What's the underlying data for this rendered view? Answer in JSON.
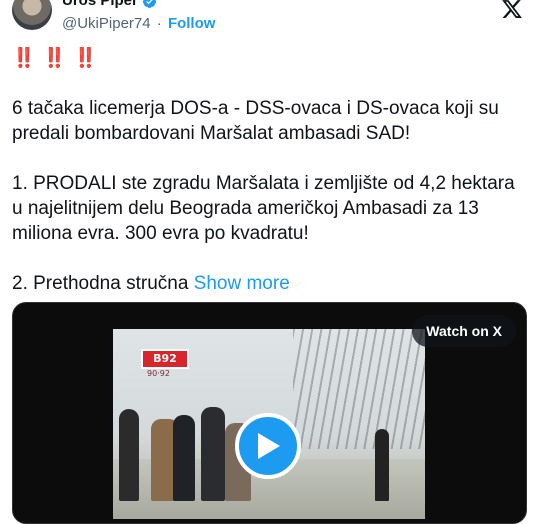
{
  "author": {
    "name": "Uros Piper",
    "handle": "@UkiPiper74",
    "separator": "·",
    "follow_label": "Follow"
  },
  "post": {
    "emoji": "‼️ ‼️ ‼️",
    "text": "6 tačaka licemerja DOS-a - DSS-ovaca i DS-ovaca koji su predali bombardovani Maršalat ambasadi SAD!\n\n1. PRODALI ste zgradu Maršalata i zemljište od 4,2 hektara u najelitnijem delu Beograda američkoj Ambasadi za 13 miliona evra. 300 evra po kvadratu!\n\n2. Prethodna stručna ",
    "show_more": "Show more"
  },
  "media": {
    "watch_label": "Watch on X",
    "channel_logo": "B92",
    "channel_sub": "90·92"
  },
  "colors": {
    "accent": "#1d9bf0",
    "text": "#0f1419",
    "secondary": "#536471"
  },
  "icons": {
    "verified": "verified-badge-icon",
    "brand": "x-logo-icon",
    "play": "play-icon"
  }
}
